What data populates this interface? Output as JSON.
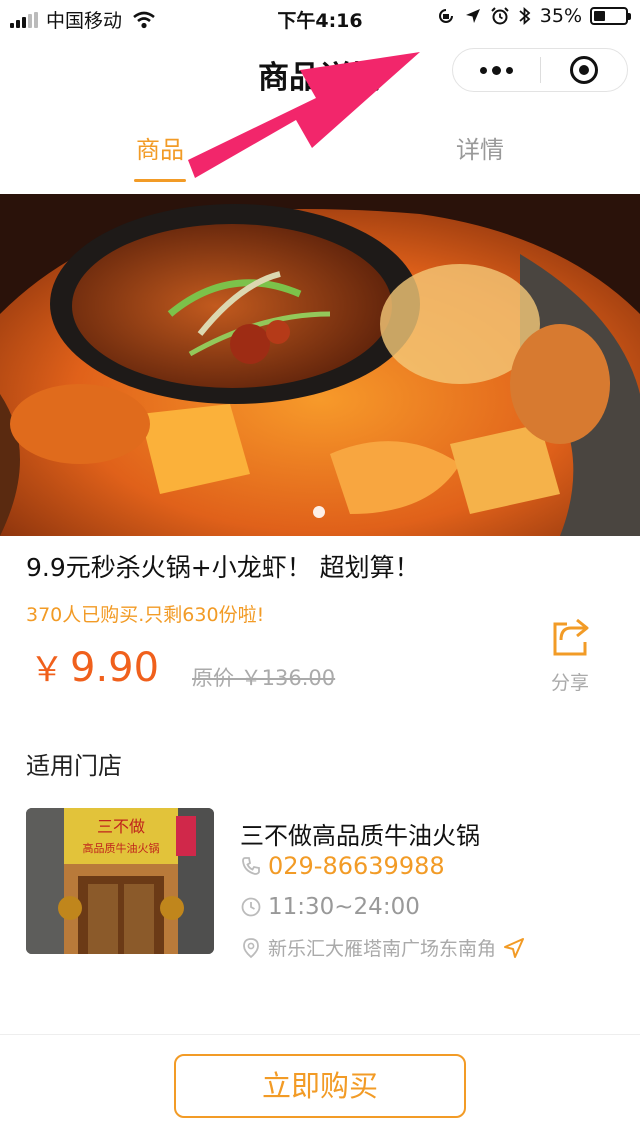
{
  "status_bar": {
    "carrier": "中国移动",
    "time": "下午4:16",
    "battery": "35%",
    "battery_level": 0.35
  },
  "nav": {
    "title": "商品详情",
    "more_icon": "more-dots-icon",
    "close_icon": "target-circle-icon"
  },
  "tabs": [
    {
      "label": "商品",
      "active": true
    },
    {
      "label": "详情",
      "active": false
    }
  ],
  "product": {
    "title": "9.9元秒杀火锅+小龙虾！ 超划算！",
    "sales_info": "370人已购买.只剩630份啦!",
    "price_symbol": "￥",
    "price": "9.90",
    "original_price": "原价 ￥136.00",
    "share_label": "分享"
  },
  "stores": {
    "section_title": "适用门店",
    "items": [
      {
        "name": "三不做高品质牛油火锅",
        "phone": "029-86639988",
        "hours": "11:30~24:00",
        "address": "新乐汇大雁塔南广场东南角",
        "sign_text": "三不做",
        "sign_subtext": "高品质牛油火锅"
      }
    ]
  },
  "actions": {
    "buy_label": "立即购买"
  },
  "colors": {
    "accent": "#f29b26",
    "price": "#f0601c",
    "annotation_arrow": "#f2266b"
  }
}
